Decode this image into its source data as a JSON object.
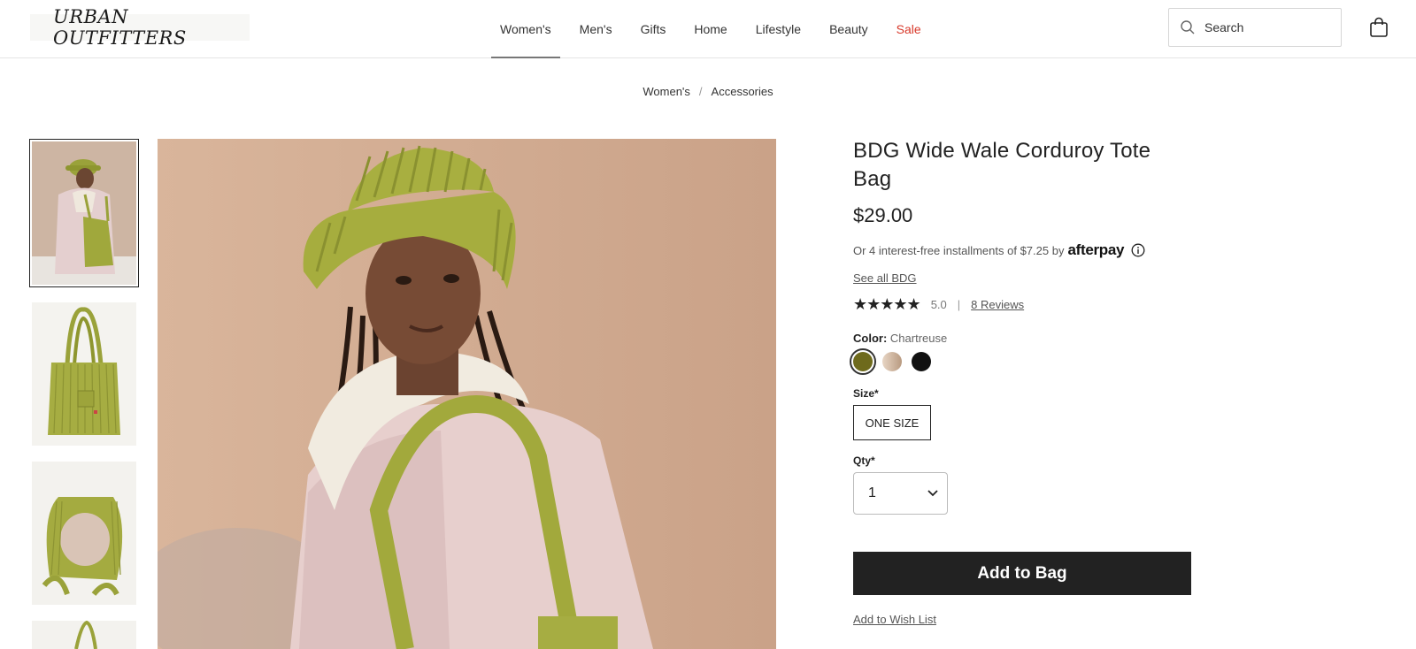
{
  "header": {
    "logo_text": "URBAN OUTFITTERS",
    "nav": [
      {
        "label": "Women's",
        "active": true
      },
      {
        "label": "Men's"
      },
      {
        "label": "Gifts"
      },
      {
        "label": "Home"
      },
      {
        "label": "Lifestyle"
      },
      {
        "label": "Beauty"
      },
      {
        "label": "Sale",
        "color": "#d8392b"
      }
    ],
    "search_placeholder": "Search"
  },
  "breadcrumb": [
    "Women's",
    "Accessories"
  ],
  "product": {
    "title": "BDG Wide Wale Corduroy Tote Bag",
    "price": "$29.00",
    "afterpay_text": "Or 4 interest-free installments of $7.25 by",
    "afterpay_brand": "afterpay",
    "see_all": "See all BDG",
    "rating_stars": "★★★★★",
    "rating_value": "5.0",
    "reviews": "8 Reviews",
    "color_label": "Color:",
    "color_value": "Chartreuse",
    "swatches": [
      "#6e6a1c",
      "#d9c2ad",
      "#111111"
    ],
    "size_label": "Size*",
    "size_option": "ONE SIZE",
    "qty_label": "Qty*",
    "qty_value": "1",
    "add_to_bag": "Add to Bag",
    "wishlist": "Add to Wish List"
  },
  "colors": {
    "accent_sale": "#d8392b",
    "button_dark": "#222222",
    "chartreuse": "#9aa23a"
  }
}
